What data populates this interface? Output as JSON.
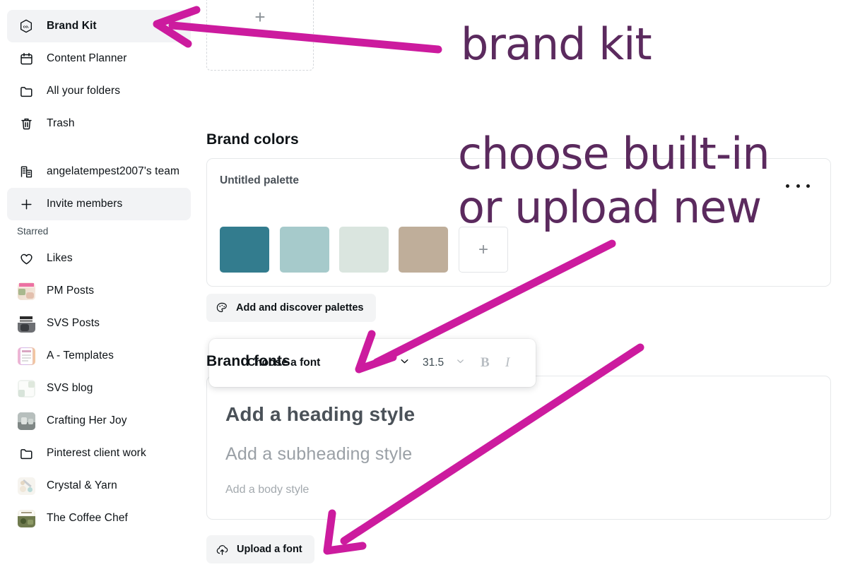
{
  "sidebar": {
    "primary_items": [
      {
        "label": "Brand Kit",
        "icon": "brand-kit-hexagon-icon",
        "active": true
      },
      {
        "label": "Content Planner",
        "icon": "calendar-icon",
        "active": false
      },
      {
        "label": "All your folders",
        "icon": "folder-icon",
        "active": false
      },
      {
        "label": "Trash",
        "icon": "trash-icon",
        "active": false
      }
    ],
    "team_items": [
      {
        "label": "angelatempest2007's team",
        "icon": "building-icon",
        "active": false
      },
      {
        "label": "Invite members",
        "icon": "plus-icon",
        "active": true
      }
    ],
    "starred_label": "Starred",
    "starred_items": [
      {
        "label": "Likes",
        "icon": "heart-icon",
        "thumb": false
      },
      {
        "label": "PM Posts",
        "icon": "thumbnail-image",
        "thumb": true
      },
      {
        "label": "SVS Posts",
        "icon": "thumbnail-image",
        "thumb": true
      },
      {
        "label": "A - Templates",
        "icon": "thumbnail-image",
        "thumb": true
      },
      {
        "label": "SVS blog",
        "icon": "thumbnail-image",
        "thumb": true
      },
      {
        "label": "Crafting Her Joy",
        "icon": "thumbnail-image",
        "thumb": true
      },
      {
        "label": "Pinterest client work",
        "icon": "folder-icon",
        "thumb": false
      },
      {
        "label": "Crystal & Yarn",
        "icon": "thumbnail-image",
        "thumb": true
      },
      {
        "label": "The Coffee Chef",
        "icon": "thumbnail-image",
        "thumb": true
      }
    ]
  },
  "main": {
    "logo_upload": {
      "icon": "plus-icon"
    },
    "brand_colors_title": "Brand colors",
    "palette": {
      "name": "Untitled palette",
      "swatches": [
        "#337c8e",
        "#a6cacb",
        "#dae5df",
        "#bfae9a"
      ],
      "add_icon": "plus-icon",
      "menu_icon": "more-options-icon"
    },
    "add_palettes_button": {
      "label": "Add and discover palettes",
      "icon": "palette-icon"
    },
    "brand_fonts_title": "Brand fonts",
    "font_toolbar": {
      "font_name": "Choose a font",
      "font_size": "31.5",
      "bold_label": "B",
      "italic_label": "I",
      "chevron_icon": "chevron-down-icon"
    },
    "type_samples": {
      "heading": "Add a heading style",
      "subheading": "Add a subheading style",
      "body": "Add a body style"
    },
    "upload_font_button": {
      "label": "Upload a font",
      "icon": "upload-cloud-icon"
    }
  },
  "annotations": {
    "color": "#5b2a5e",
    "arrow_color": "#cc1b9e",
    "note_1": "brand kit",
    "note_2_line_1": "choose built-in",
    "note_2_line_2": "or upload new"
  }
}
